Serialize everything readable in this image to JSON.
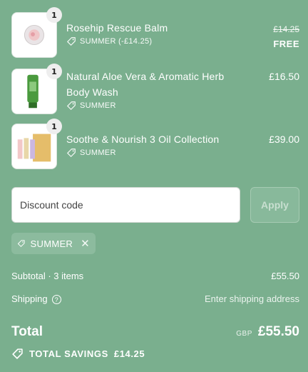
{
  "items": [
    {
      "title": "Rosehip Rescue Balm",
      "quantity": "1",
      "discount": "SUMMER (-£14.25)",
      "original_price": "£14.25",
      "price": "FREE"
    },
    {
      "title": "Natural Aloe Vera & Aromatic Herb Body Wash",
      "quantity": "1",
      "discount": "SUMMER",
      "price": "£16.50"
    },
    {
      "title": "Soothe & Nourish 3 Oil Collection",
      "quantity": "1",
      "discount": "SUMMER",
      "price": "£39.00"
    }
  ],
  "discount": {
    "placeholder": "Discount code",
    "apply_label": "Apply",
    "applied_code": "SUMMER",
    "remove_icon": "close-icon"
  },
  "summary": {
    "subtotal_label": "Subtotal · 3 items",
    "subtotal_value": "£55.50",
    "shipping_label": "Shipping",
    "shipping_value": "Enter shipping address",
    "total_label": "Total",
    "currency": "GBP",
    "total_value": "£55.50",
    "savings_label": "TOTAL SAVINGS",
    "savings_value": "£14.25"
  },
  "colors": {
    "background": "#7aaf8e",
    "text": "#ffffff"
  }
}
